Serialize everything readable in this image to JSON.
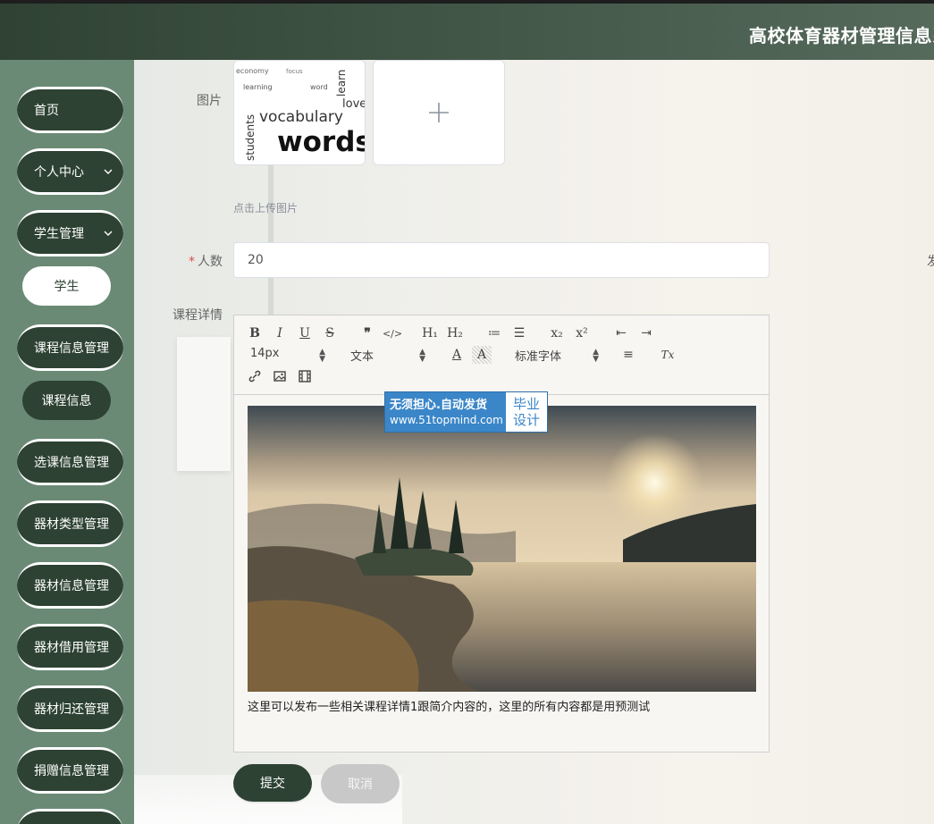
{
  "header": {
    "title": "高校体育器材管理信息系"
  },
  "sidebar": {
    "items": [
      {
        "label": "首页"
      },
      {
        "label": "个人中心"
      },
      {
        "label": "学生管理"
      },
      {
        "label": "学生"
      },
      {
        "label": "课程信息管理"
      },
      {
        "label": "课程信息"
      },
      {
        "label": "选课信息管理"
      },
      {
        "label": "器材类型管理"
      },
      {
        "label": "器材信息管理"
      },
      {
        "label": "器材借用管理"
      },
      {
        "label": "器材归还管理"
      },
      {
        "label": "捐赠信息管理"
      }
    ]
  },
  "form": {
    "image_label": "图片",
    "image_preview_words": [
      "vocabulary",
      "words",
      "students",
      "economy",
      "learning",
      "love",
      "learn",
      "focus",
      "word"
    ],
    "upload_plus": "+",
    "upload_tip": "点击上传图片",
    "people_label": "人数",
    "people_required": "*",
    "people_value": "20",
    "cut_off_label": "发",
    "details_label": "课程详情",
    "editor": {
      "toolbar": {
        "bold": "B",
        "italic": "I",
        "underline": "U",
        "strike": "S",
        "quote": "❞",
        "code": "</>",
        "h1": "H₁",
        "h2": "H₂",
        "ordered_list": "≔",
        "bullet_list": "☰",
        "subscript": "x₂",
        "superscript": "x²",
        "outdent": "⇤",
        "indent": "⇥",
        "size_select": "14px",
        "header_select": "文本",
        "font_color": "A",
        "background_color": "A",
        "font_select": "标准字体",
        "align": "≡",
        "clean": "Tx",
        "link": "🔗",
        "image": "▣",
        "video": "▤"
      },
      "content_text": "这里可以发布一些相关课程详情1跟简介内容的，这里的所有内容都是用预测试"
    },
    "submit_label": "提交",
    "cancel_label": "取消"
  },
  "watermark": {
    "line1": "无须担心.自动发货",
    "line2": "www.51topmind.com",
    "badge_top": "毕业",
    "badge_bottom": "设计"
  }
}
